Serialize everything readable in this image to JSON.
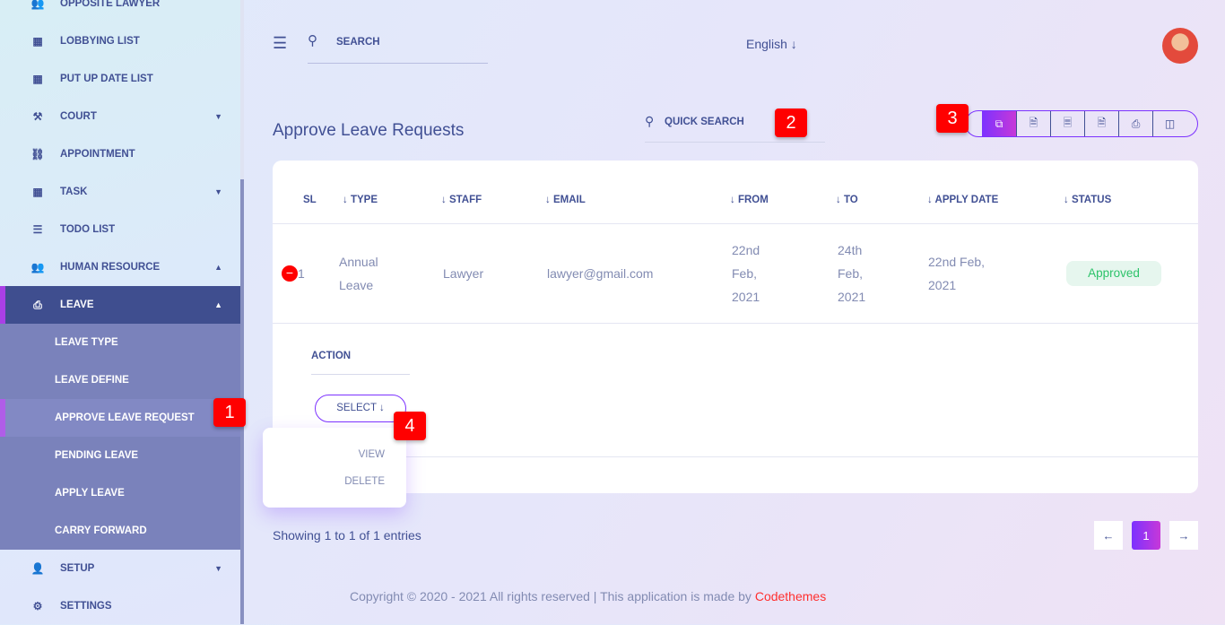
{
  "sidebar": {
    "items": [
      {
        "label": "Opposite Lawyer",
        "icon": "users-icon"
      },
      {
        "label": "Lobbying List",
        "icon": "grid-icon"
      },
      {
        "label": "Put Up Date List",
        "icon": "grid-icon"
      },
      {
        "label": "Court",
        "icon": "gavel-icon",
        "caret": "▼"
      },
      {
        "label": "Appointment",
        "icon": "handshake-icon"
      },
      {
        "label": "Task",
        "icon": "grid-icon",
        "caret": "▼"
      },
      {
        "label": "Todo List",
        "icon": "list-icon"
      },
      {
        "label": "Human Resource",
        "icon": "users-icon",
        "caret": "▲"
      },
      {
        "label": "Leave",
        "icon": "printer-icon",
        "caret": "▲"
      }
    ],
    "sub": [
      "Leave Type",
      "Leave Define",
      "Approve Leave Request",
      "Pending Leave",
      "Apply Leave",
      "Carry Forward"
    ],
    "after": [
      {
        "label": "Setup",
        "icon": "user-icon",
        "caret": "▼"
      },
      {
        "label": "Settings",
        "icon": "gear-icon"
      }
    ]
  },
  "header": {
    "search": "SEARCH",
    "language": "English"
  },
  "page": {
    "title": "Approve Leave Requests",
    "quick_search": "QUICK SEARCH"
  },
  "annotations": [
    "1",
    "2",
    "3",
    "4"
  ],
  "table": {
    "headers": [
      "SL",
      "TYPE",
      "STAFF",
      "EMAIL",
      "FROM",
      "TO",
      "APPLY DATE",
      "STATUS"
    ],
    "row": {
      "sl": "1",
      "type": "Annual Leave",
      "staff": "Lawyer",
      "email": "lawyer@gmail.com",
      "from": "22nd Feb, 2021",
      "to": "24th Feb, 2021",
      "apply": "22nd Feb, 2021",
      "status": "Approved"
    },
    "action_label": "ACTION",
    "select": "SELECT",
    "menu": [
      "VIEW",
      "DELETE"
    ]
  },
  "footer": {
    "showing": "Showing 1 to 1 of 1 entries",
    "page": "1",
    "copyright": "Copyright © 2020 - 2021 All rights reserved | This application is made by ",
    "brand": "Codethemes"
  },
  "colors": {
    "accent": "#7c32ff",
    "status_green": "#2dc36a",
    "brand_red": "#ff2f2f"
  }
}
